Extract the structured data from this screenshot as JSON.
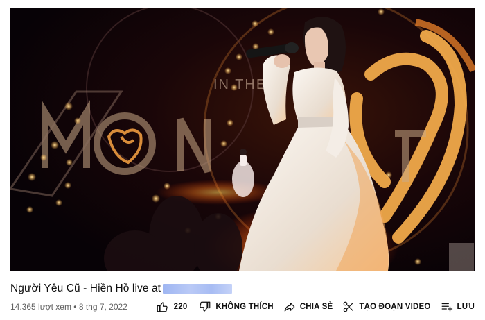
{
  "video": {
    "title": "Người Yêu Cũ - Hiền Hồ live at",
    "stage_text": "IN THE",
    "views": "14.365 lượt xem",
    "dot": " • ",
    "date": "8 thg 7, 2022"
  },
  "actions": {
    "like_count": "220",
    "dislike_label": "KHÔNG THÍCH",
    "share_label": "CHIA SẺ",
    "clip_label": "TẠO ĐOẠN VIDEO",
    "save_label": "LƯU"
  },
  "colors": {
    "accent_orange": "#e8a24a",
    "dress": "#f2ece6",
    "redaction": "#a9bdf4"
  },
  "icons": [
    "thumb-up-icon",
    "thumb-down-icon",
    "share-icon",
    "scissors-icon",
    "playlist-add-icon"
  ]
}
